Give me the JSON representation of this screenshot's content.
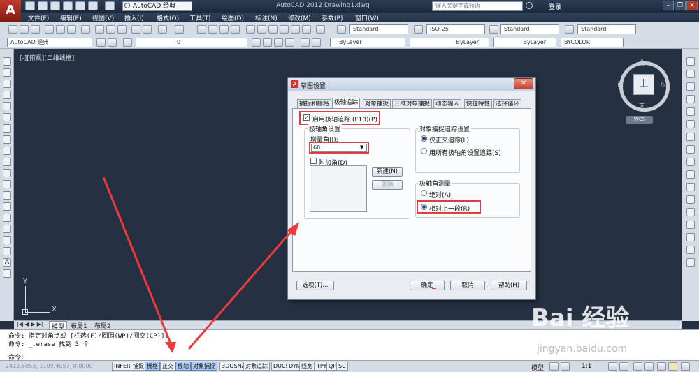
{
  "titlebar": {
    "workspace": "AutoCAD 经典",
    "title": "AutoCAD 2012    Drawing1.dwg",
    "search_placeholder": "键入关键字或短语",
    "login": "登录"
  },
  "menu": [
    "文件(F)",
    "编辑(E)",
    "视图(V)",
    "插入(I)",
    "格式(O)",
    "工具(T)",
    "绘图(D)",
    "标注(N)",
    "修改(M)",
    "参数(P)",
    "窗口(W)"
  ],
  "toolbar": {
    "text_style": "Standard",
    "dim_style": "ISO-25",
    "table_style": "Standard",
    "mleader_style": "Standard",
    "workspace2": "AutoCAD 经典",
    "layer": "0",
    "color": "ByLayer",
    "linetype": "ByLayer",
    "lineweight": "ByLayer",
    "plotstyle": "BYCOLOR"
  },
  "viewport": {
    "label": "[-][俯视][二维线框]",
    "compass": {
      "north": "北",
      "south": "南",
      "east": "东",
      "west": "西",
      "top": "上"
    },
    "wcs": "WCS",
    "ucs_x": "X",
    "ucs_y": "Y"
  },
  "layout_tabs": [
    "模型",
    "布局1",
    "布局2"
  ],
  "command": {
    "line1": "命令: 指定对角点或 [栏选(F)/圈围(WP)/圈交(CP)]:",
    "line2": "命令: _.erase 找到 3 个",
    "prompt": "命令:"
  },
  "statusbar": {
    "coords": "2412.5053, 1109.4057, 0.0000",
    "buttons": [
      "INFER",
      "捕捉",
      "栅格",
      "正交",
      "极轴",
      "对象捕捉",
      "3DOSNAP",
      "对象追踪",
      "DUCS",
      "DYN",
      "线宽",
      "TPY",
      "QP",
      "SC"
    ],
    "active": [
      "栅格",
      "极轴",
      "对象捕捉"
    ],
    "model": "模型",
    "scale": "1:1"
  },
  "dialog": {
    "title": "草图设置",
    "tabs": [
      "捕捉和栅格",
      "极轴追踪",
      "对象捕捉",
      "三维对象捕捉",
      "动态输入",
      "快捷特性",
      "选择循环"
    ],
    "enable_polar": "启用极轴追踪 (F10)(P)",
    "polar_settings": "极轴角设置",
    "increment_label": "增量角(I):",
    "increment_value": "60",
    "additional": "附加角(D)",
    "new_btn": "新建(N)",
    "delete_btn": "删除",
    "osnap_track": "对象捕捉追踪设置",
    "ortho_only": "仅正交追踪(L)",
    "all_polar": "用所有极轴角设置追踪(S)",
    "measure": "极轴角测量",
    "absolute": "绝对(A)",
    "relative": "相对上一段(R)",
    "options_btn": "选项(T)...",
    "ok_btn": "确定",
    "cancel_btn": "取消",
    "help_btn": "帮助(H)"
  },
  "watermark": {
    "brand": "Bai 经验",
    "url": "jingyan.baidu.com"
  },
  "colors": {
    "canvas": "#253142",
    "highlight": "#e23c3c",
    "arrow": "#f03a3a"
  }
}
